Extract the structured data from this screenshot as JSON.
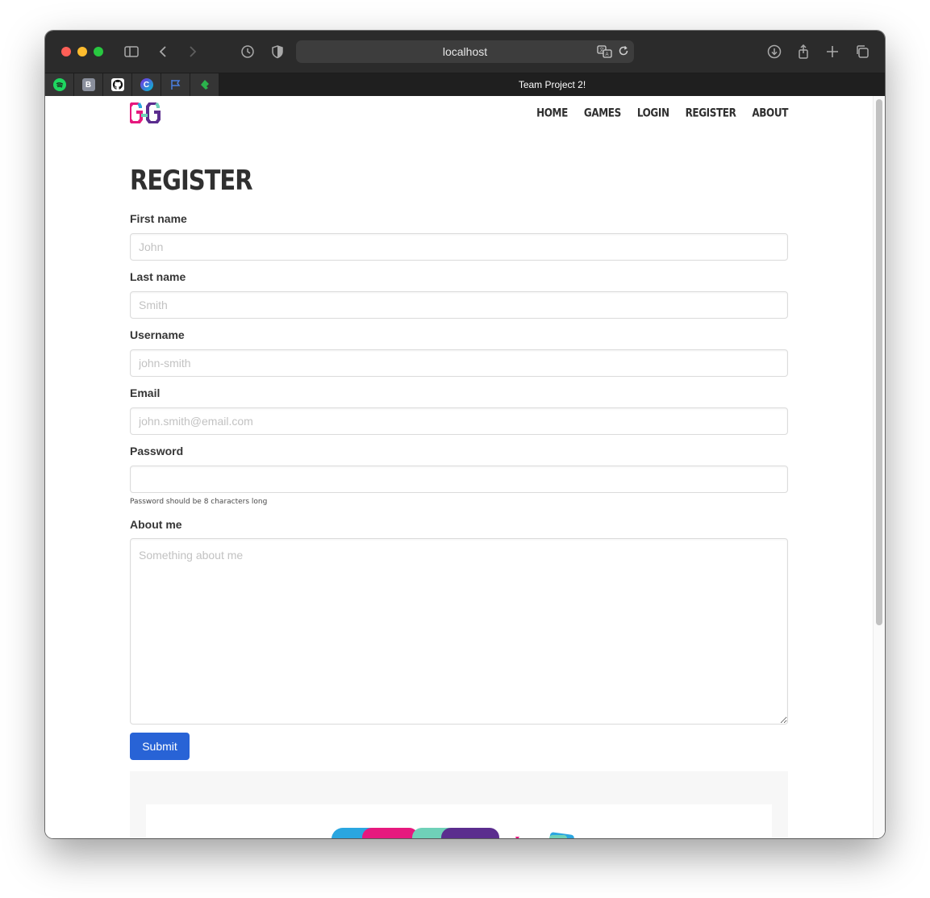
{
  "browser": {
    "url": "localhost",
    "active_tab_title": "Team Project 2!",
    "pinned_tabs": [
      {
        "name": "spotify",
        "glyph": "",
        "color": "#1ed760"
      },
      {
        "name": "bitwarden",
        "glyph": "B",
        "color": "#8a8f9c"
      },
      {
        "name": "github",
        "glyph": "",
        "color": "#ffffff"
      },
      {
        "name": "canva",
        "glyph": "C",
        "color": "#4c6ef5"
      },
      {
        "name": "flag",
        "glyph": "",
        "color": "#4a7fe0"
      },
      {
        "name": "feedly",
        "glyph": "",
        "color": "#2bb24c"
      }
    ]
  },
  "nav": {
    "items": [
      "HOME",
      "GAMES",
      "LOGIN",
      "REGISTER",
      "ABOUT"
    ]
  },
  "page": {
    "title": "REGISTER"
  },
  "form": {
    "first_name": {
      "label": "First name",
      "placeholder": "John"
    },
    "last_name": {
      "label": "Last name",
      "placeholder": "Smith"
    },
    "username": {
      "label": "Username",
      "placeholder": "john-smith"
    },
    "email": {
      "label": "Email",
      "placeholder": "john.smith@email.com"
    },
    "password": {
      "label": "Password",
      "placeholder": "",
      "help": "Password should be 8 characters long"
    },
    "about": {
      "label": "About me",
      "placeholder": "Something about me"
    },
    "submit_label": "Submit"
  },
  "colors": {
    "primary_button": "#2863d6",
    "logo_pink": "#e6197e",
    "logo_purple": "#5b2d8e",
    "logo_teal": "#6fd1b8",
    "logo_blue": "#2aa6e0"
  }
}
